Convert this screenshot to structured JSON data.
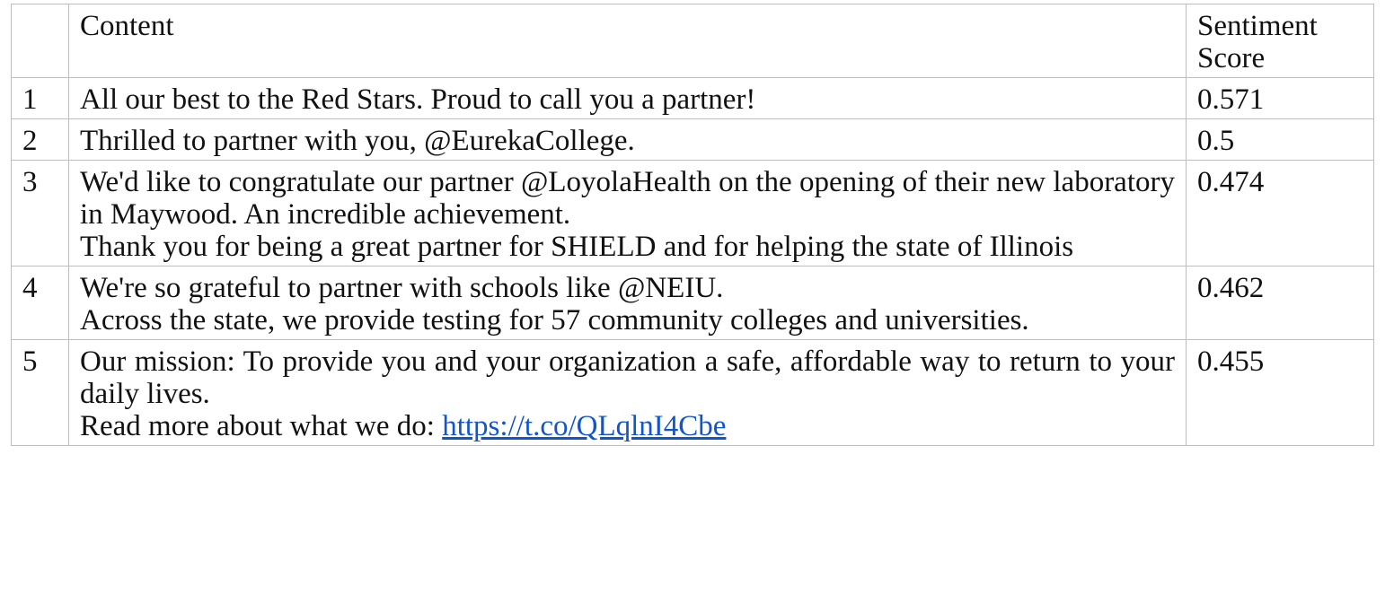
{
  "table": {
    "headers": {
      "index": "",
      "content": "Content",
      "score": "Sentiment Score"
    },
    "rows": [
      {
        "index": "1",
        "lines": [
          "All our best to the Red Stars. Proud to call you a partner!"
        ],
        "score": "0.571"
      },
      {
        "index": "2",
        "lines": [
          "Thrilled to partner with you, @EurekaCollege."
        ],
        "score": "0.5"
      },
      {
        "index": "3",
        "lines": [
          "We'd like to congratulate our partner @LoyolaHealth on the opening of their new laboratory in Maywood. An incredible achievement.",
          "Thank you for being a great partner for SHIELD and for helping the state of Illinois"
        ],
        "score": "0.474"
      },
      {
        "index": "4",
        "lines": [
          "We're so grateful to partner with schools like @NEIU.",
          "Across the state, we provide testing for 57 community colleges and universities."
        ],
        "score": "0.462"
      },
      {
        "index": "5",
        "lines": [
          "Our mission: To provide you and your organization a safe, affordable way to return to your daily lives.",
          "Read more about what we do: "
        ],
        "link": "https://t.co/QLqlnI4Cbe",
        "score": "0.455"
      }
    ]
  }
}
